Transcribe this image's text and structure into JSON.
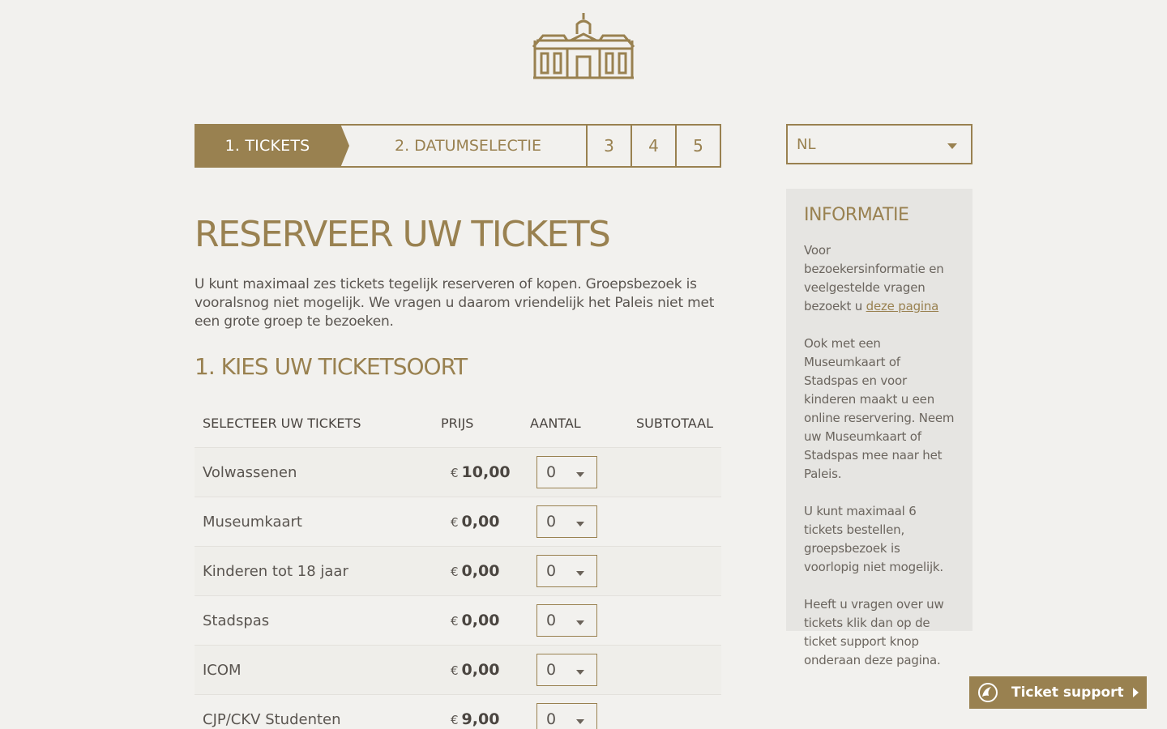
{
  "logo": {
    "icon": "palace-icon",
    "color": "#998150"
  },
  "steps": {
    "step1": "1. TICKETS",
    "step2": "2. DATUMSELECTIE",
    "step3": "3",
    "step4": "4",
    "step5": "5"
  },
  "language": {
    "selected": "NL"
  },
  "main": {
    "title": "RESERVEER UW TICKETS",
    "intro": "U kunt maximaal zes tickets tegelijk reserveren of kopen. Groepsbezoek is vooralsnog niet mogelijk. We vragen u daarom vriendelijk het Paleis niet met een grote groep te bezoeken.",
    "section_title": "1. KIES UW TICKETSOORT"
  },
  "table": {
    "headers": [
      "SELECTEER UW TICKETS",
      "PRIJS",
      "AANTAL",
      "SUBTOTAAL"
    ],
    "currency": "€",
    "rows": [
      {
        "name": "Volwassenen",
        "price": "10,00",
        "qty": "0"
      },
      {
        "name": "Museumkaart",
        "price": "0,00",
        "qty": "0"
      },
      {
        "name": "Kinderen tot 18 jaar",
        "price": "0,00",
        "qty": "0"
      },
      {
        "name": "Stadspas",
        "price": "0,00",
        "qty": "0"
      },
      {
        "name": "ICOM",
        "price": "0,00",
        "qty": "0"
      },
      {
        "name": "CJP/CKV Studenten",
        "price": "9,00",
        "qty": "0"
      }
    ]
  },
  "info": {
    "title": "INFORMATIE",
    "p1_text": "Voor bezoekersinformatie en veelgestelde vragen bezoekt u ",
    "p1_link": "deze pagina",
    "p2": "Ook met een Museumkaart of Stadspas en voor kinderen maakt u een online reservering. Neem uw Museumkaart of Stadspas mee naar het Paleis.",
    "p3": "U kunt maximaal 6 tickets bestellen, groepsbezoek is voorlopig niet mogelijk.",
    "p4": "Heeft u vragen over uw tickets klik dan op de ticket support knop onderaan deze pagina."
  },
  "support": {
    "label": "Ticket support"
  },
  "colors": {
    "accent": "#998150",
    "background": "#f2f1ee",
    "panel": "#e6e5e2"
  }
}
